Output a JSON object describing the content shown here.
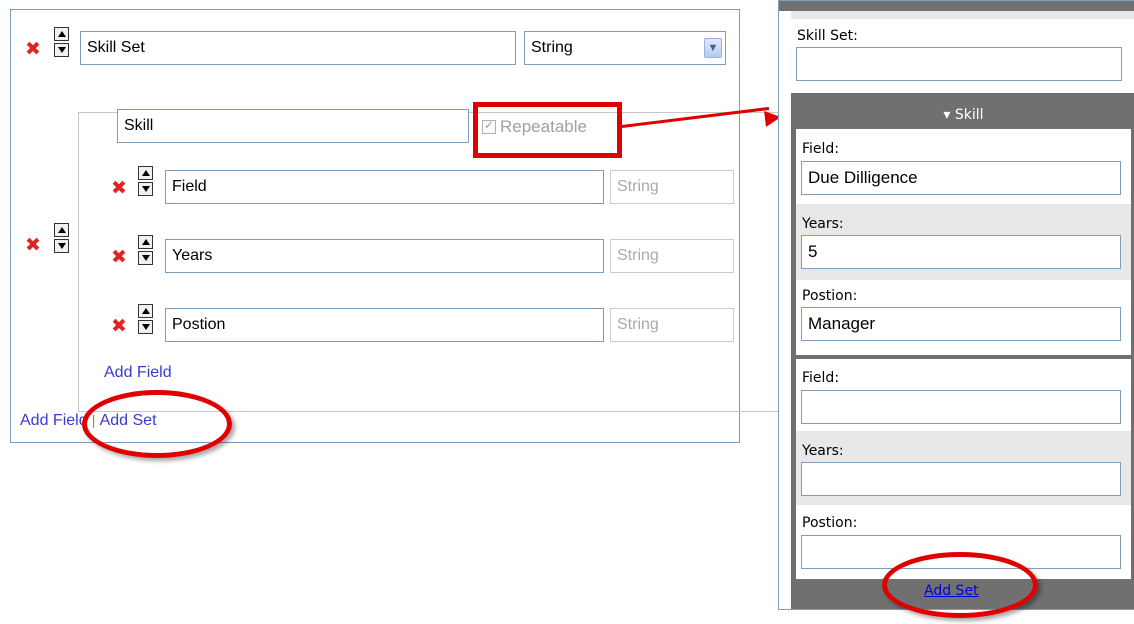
{
  "editor": {
    "top_field": {
      "name": "Skill Set",
      "type": "String"
    },
    "set": {
      "name": "Skill",
      "repeatable_label": "Repeatable",
      "repeatable_checked": true,
      "fields": [
        {
          "name": "Field",
          "type": "String"
        },
        {
          "name": "Years",
          "type": "String"
        },
        {
          "name": "Postion",
          "type": "String"
        }
      ],
      "add_field_label": "Add Field"
    },
    "footer": {
      "add_field_label": "Add Field",
      "separator": "|",
      "add_set_label": "Add Set"
    }
  },
  "preview": {
    "skill_set_label": "Skill Set:",
    "skill_set_value": "",
    "set_header": "▾ Skill",
    "records": [
      {
        "field_label": "Field:",
        "field_value": "Due Dilligence",
        "years_label": "Years:",
        "years_value": "5",
        "position_label": "Postion:",
        "position_value": "Manager"
      },
      {
        "field_label": "Field:",
        "field_value": "",
        "years_label": "Years:",
        "years_value": "",
        "position_label": "Postion:",
        "position_value": ""
      }
    ],
    "add_set_label": "Add Set"
  },
  "colors": {
    "highlight": "#e00000",
    "link": "#3a3acf",
    "set_background": "#707070"
  },
  "icons": {
    "delete": "delete-icon",
    "move_up": "arrow-up-icon",
    "move_down": "arrow-down-icon",
    "dropdown": "chevron-down-icon"
  }
}
